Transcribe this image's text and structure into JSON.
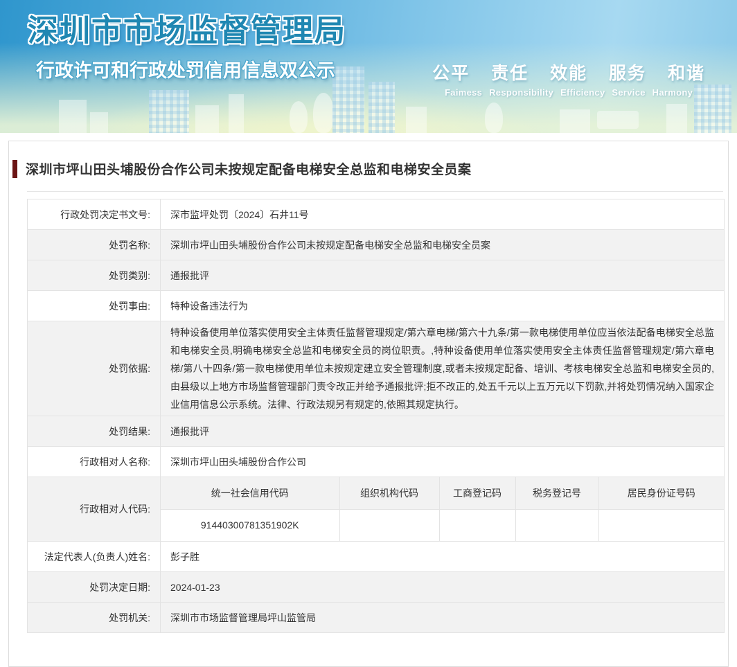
{
  "banner": {
    "title": "深圳市市场监督管理局",
    "subtitle": "行政许可和行政处罚信用信息双公示",
    "motto_cn": "公平 责任 效能 服务 和谐",
    "motto_en": "Faimess Responsibility Efficiency Service Harmony",
    "accent_color": "#1f87b2"
  },
  "case": {
    "title": "深圳市坪山田头埔股份合作公司未按规定配备电梯安全总监和电梯安全员案",
    "accent_bar_color": "#6b1414"
  },
  "table": {
    "rows": [
      {
        "label": "行政处罚决定书文号:",
        "value": "深市监坪处罚〔2024〕石井11号"
      },
      {
        "label": "处罚名称:",
        "value": "深圳市坪山田头埔股份合作公司未按规定配备电梯安全总监和电梯安全员案"
      },
      {
        "label": "处罚类别:",
        "value": "通报批评"
      },
      {
        "label": "处罚事由:",
        "value": "特种设备违法行为"
      },
      {
        "label": "处罚依据:",
        "value": "特种设备使用单位落实使用安全主体责任监督管理规定/第六章电梯/第六十九条/第一款电梯使用单位应当依法配备电梯安全总监和电梯安全员,明确电梯安全总监和电梯安全员的岗位职责。,特种设备使用单位落实使用安全主体责任监督管理规定/第六章电梯/第八十四条/第一款电梯使用单位未按规定建立安全管理制度,或者未按规定配备、培训、考核电梯安全总监和电梯安全员的,由县级以上地方市场监督管理部门责令改正并给予通报批评;拒不改正的,处五千元以上五万元以下罚款,并将处罚情况纳入国家企业信用信息公示系统。法律、行政法规另有规定的,依照其规定执行。"
      },
      {
        "label": "处罚结果:",
        "value": "通报批评"
      },
      {
        "label": "行政相对人名称:",
        "value": "深圳市坪山田头埔股份合作公司"
      },
      {
        "label": "法定代表人(负责人)姓名:",
        "value": "彭子胜"
      },
      {
        "label": "处罚决定日期:",
        "value": "2024-01-23"
      },
      {
        "label": "处罚机关:",
        "value": "深圳市市场监督管理局坪山监管局"
      }
    ],
    "code_row": {
      "label": "行政相对人代码:",
      "columns": [
        "统一社会信用代码",
        "组织机构代码",
        "工商登记码",
        "税务登记号",
        "居民身份证号码"
      ],
      "values": [
        "91440300781351902K",
        "",
        "",
        "",
        ""
      ]
    }
  }
}
